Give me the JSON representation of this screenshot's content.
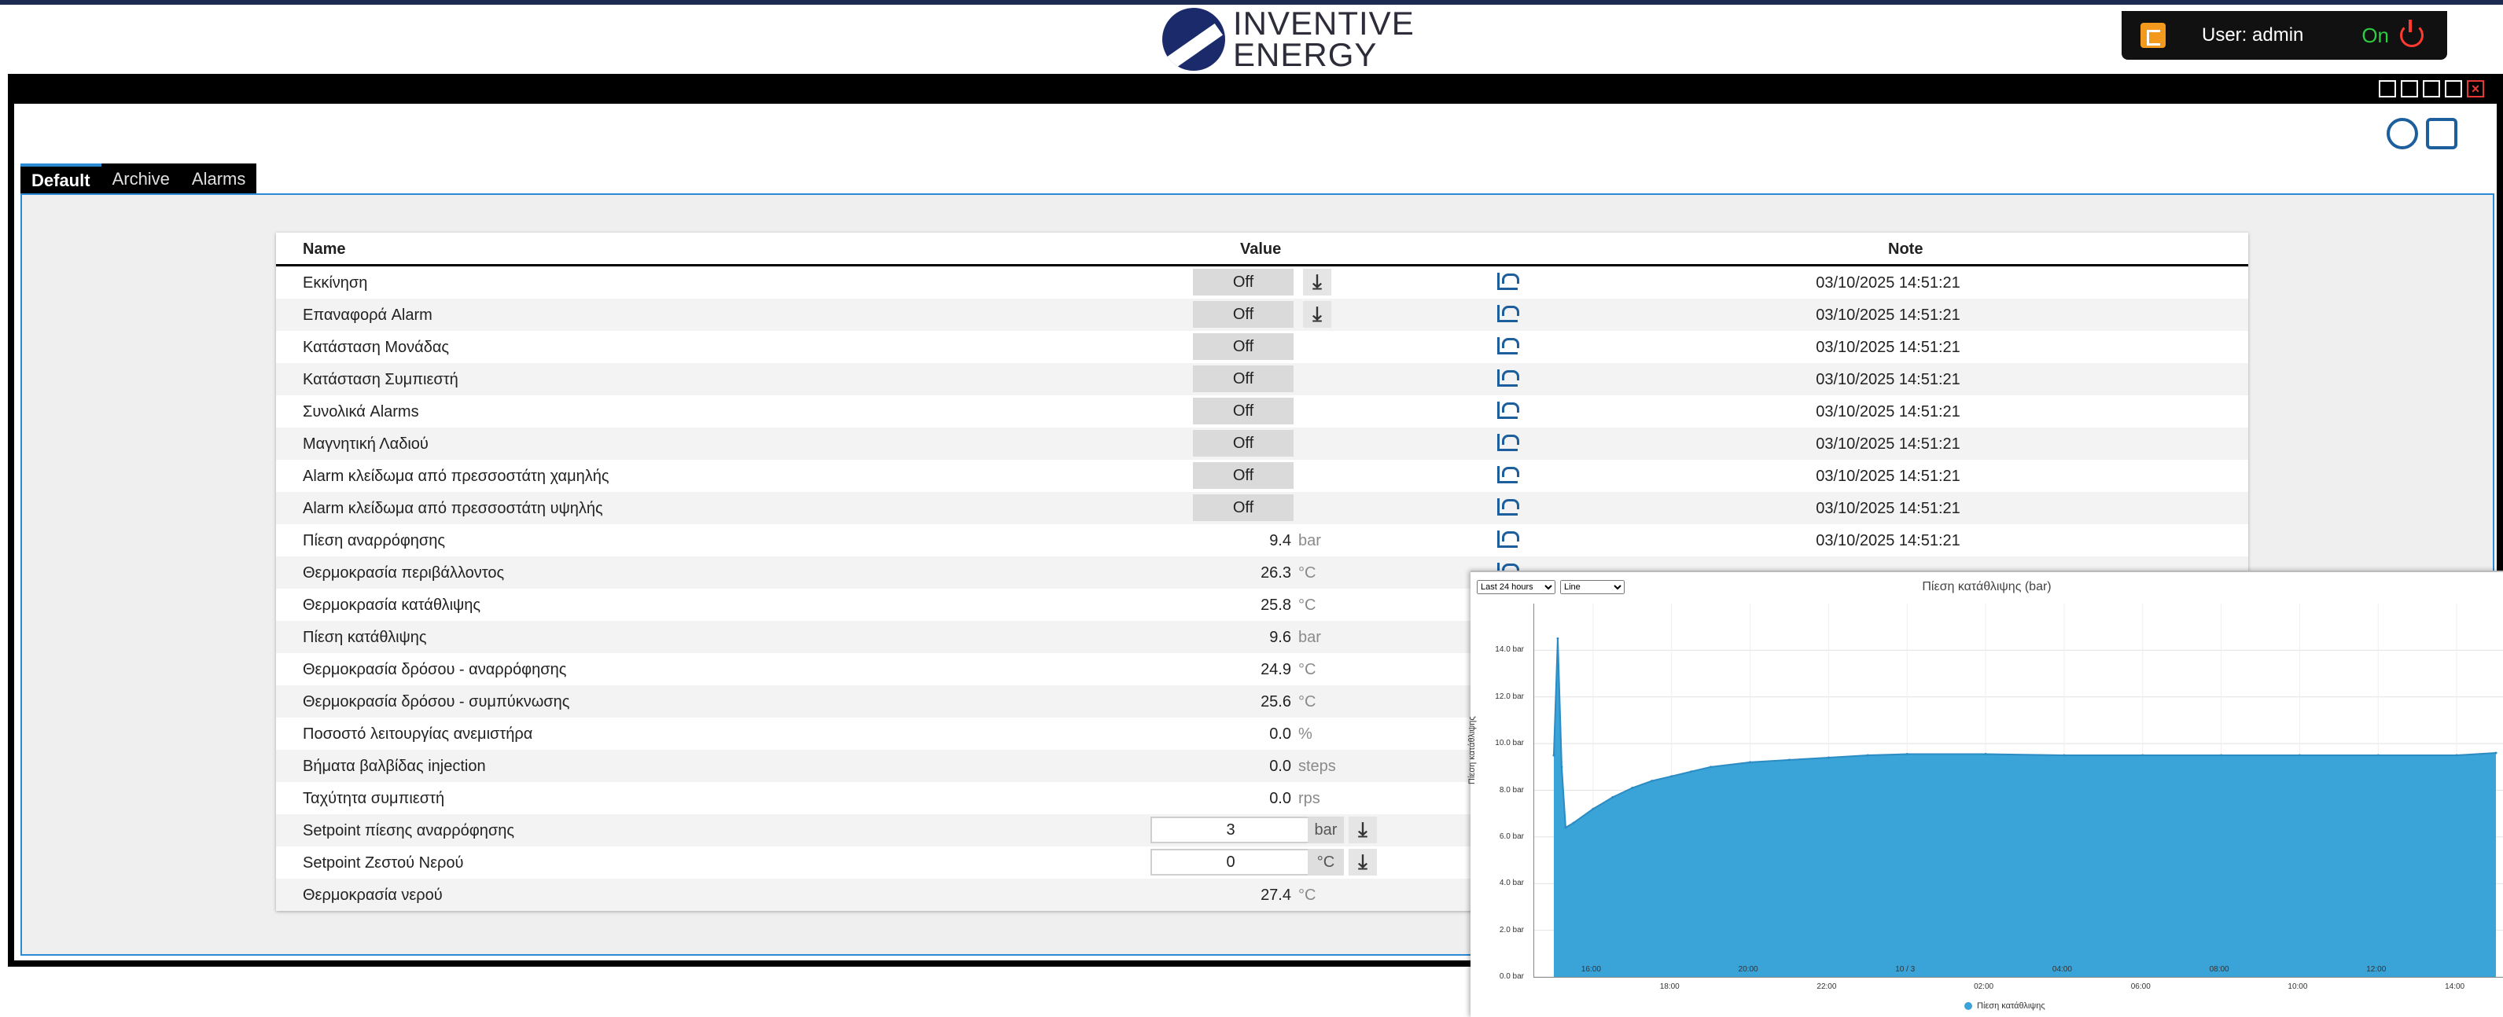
{
  "header": {
    "logo_line1": "INVENTIVE",
    "logo_line2": "ENERGY",
    "user_label": "User: admin",
    "status": "On"
  },
  "tabs": [
    "Default",
    "Archive",
    "Alarms"
  ],
  "table": {
    "headers": {
      "name": "Name",
      "value": "Value",
      "note": "Note"
    },
    "rows": [
      {
        "name": "Εκκίνηση",
        "value": "Off",
        "type": "state",
        "download": true,
        "note": "03/10/2025 14:51:21"
      },
      {
        "name": "Επαναφορά Alarm",
        "value": "Off",
        "type": "state",
        "download": true,
        "note": "03/10/2025 14:51:21"
      },
      {
        "name": "Κατάσταση Μονάδας",
        "value": "Off",
        "type": "state",
        "note": "03/10/2025 14:51:21"
      },
      {
        "name": "Κατάσταση Συμπιεστή",
        "value": "Off",
        "type": "state",
        "note": "03/10/2025 14:51:21"
      },
      {
        "name": "Συνολικά Alarms",
        "value": "Off",
        "type": "state",
        "note": "03/10/2025 14:51:21"
      },
      {
        "name": "Μαγνητική Λαδιού",
        "value": "Off",
        "type": "state",
        "note": "03/10/2025 14:51:21"
      },
      {
        "name": "Alarm κλείδωμα από πρεσσοστάτη χαμηλής",
        "value": "Off",
        "type": "state",
        "note": "03/10/2025 14:51:21"
      },
      {
        "name": "Alarm κλείδωμα από πρεσσοστάτη υψηλής",
        "value": "Off",
        "type": "state",
        "note": "03/10/2025 14:51:21"
      },
      {
        "name": "Πίεση αναρρόφησης",
        "value": "9.4",
        "unit": "bar",
        "type": "num",
        "note": "03/10/2025 14:51:21"
      },
      {
        "name": "Θερμοκρασία περιβάλλοντος",
        "value": "26.3",
        "unit": "°C",
        "type": "num"
      },
      {
        "name": "Θερμοκρασία κατάθλιψης",
        "value": "25.8",
        "unit": "°C",
        "type": "num"
      },
      {
        "name": "Πίεση κατάθλιψης",
        "value": "9.6",
        "unit": "bar",
        "type": "num"
      },
      {
        "name": "Θερμοκρασία δρόσου - αναρρόφησης",
        "value": "24.9",
        "unit": "°C",
        "type": "num"
      },
      {
        "name": "Θερμοκρασία δρόσου - συμπύκνωσης",
        "value": "25.6",
        "unit": "°C",
        "type": "num"
      },
      {
        "name": "Ποσοστό λειτουργίας ανεμιστήρα",
        "value": "0.0",
        "unit": "%",
        "type": "num"
      },
      {
        "name": "Βήματα βαλβίδας injection",
        "value": "0.0",
        "unit": "steps",
        "type": "num"
      },
      {
        "name": "Ταχύτητα συμπιεστή",
        "value": "0.0",
        "unit": "rps",
        "type": "num"
      },
      {
        "name": "Setpoint πίεσης αναρρόφησης",
        "value": "3",
        "unit": "bar",
        "type": "setpoint"
      },
      {
        "name": "Setpoint Ζεστού Νερού",
        "value": "0",
        "unit": "°C",
        "type": "setpoint"
      },
      {
        "name": "Θερμοκρασία νερού",
        "value": "27.4",
        "unit": "°C",
        "type": "num"
      }
    ]
  },
  "chart_popup": {
    "range_select": "Last 24 hours",
    "type_select": "Line",
    "title": "Πίεση κατάθλιψης (bar)"
  },
  "chart_data": {
    "type": "area",
    "title": "Πίεση κατάθλιψης (bar)",
    "ylabel": "Πίεση κατάθλιψης",
    "ylim": [
      0,
      16
    ],
    "yticks": [
      "0.0 bar",
      "2.0 bar",
      "4.0 bar",
      "6.0 bar",
      "8.0 bar",
      "10.0 bar",
      "12.0 bar",
      "14.0 bar"
    ],
    "xticks": [
      "16:00",
      "18:00",
      "20:00",
      "22:00",
      "10 / 3",
      "02:00",
      "04:00",
      "06:00",
      "08:00",
      "10:00",
      "12:00",
      "14:00"
    ],
    "legend": [
      "Πίεση κατάθλιψης"
    ],
    "color": "#3aa3d8",
    "series": [
      {
        "name": "Πίεση κατάθλιψης",
        "x": [
          15.0,
          15.1,
          15.2,
          15.3,
          15.5,
          16.0,
          16.5,
          17.0,
          17.5,
          18.0,
          18.5,
          19.0,
          20.0,
          21.0,
          22.0,
          23.0,
          24.0,
          26.0,
          28.0,
          30.0,
          32.0,
          34.0,
          36.0,
          38.0,
          39.0
        ],
        "y": [
          9.5,
          14.5,
          9.0,
          6.4,
          6.6,
          7.2,
          7.7,
          8.1,
          8.4,
          8.6,
          8.8,
          9.0,
          9.2,
          9.3,
          9.4,
          9.5,
          9.55,
          9.55,
          9.5,
          9.5,
          9.5,
          9.5,
          9.5,
          9.5,
          9.6
        ]
      }
    ]
  }
}
